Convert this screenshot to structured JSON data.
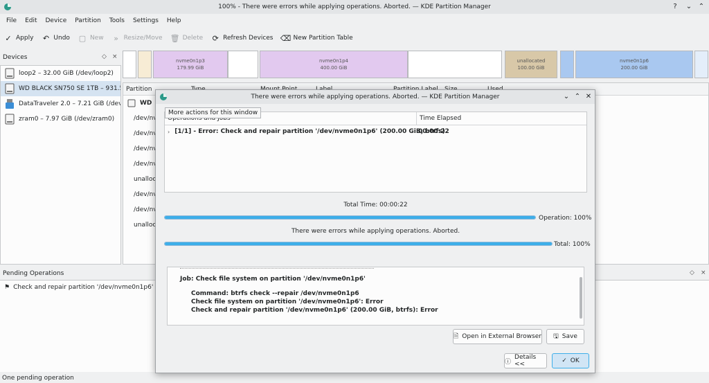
{
  "window": {
    "title": "100% - There were errors while applying operations. Aborted. — KDE Partition Manager"
  },
  "menu": [
    "File",
    "Edit",
    "Device",
    "Partition",
    "Tools",
    "Settings",
    "Help"
  ],
  "toolbar": {
    "apply": "Apply",
    "undo": "Undo",
    "new": "New",
    "resize_move": "Resize/Move",
    "delete": "Delete",
    "refresh": "Refresh Devices",
    "new_table": "New Partition Table"
  },
  "devices": {
    "header": "Devices",
    "items": [
      {
        "label": "loop2 – 32.00 GiB (/dev/loop2)",
        "icon": "drive-harddisk-icon"
      },
      {
        "label": "WD BLACK SN750 SE 1TB – 931.5...",
        "icon": "drive-harddisk-icon"
      },
      {
        "label": "DataTraveler 2.0 – 7.21 GiB (/dev...",
        "icon": "drive-removable-media-usb-icon"
      },
      {
        "label": "zram0 – 7.97 GiB (/dev/zram0)",
        "icon": "drive-harddisk-icon"
      }
    ]
  },
  "partition_map": {
    "segments": [
      {
        "name": "nvme0n1p3",
        "size": "179.99 GiB"
      },
      {
        "name": "nvme0n1p4",
        "size": "400.00 GiB"
      },
      {
        "name": "unallocated",
        "size": "100.00 GiB"
      },
      {
        "name": "nvme0n1p6",
        "size": "200.00 GiB"
      }
    ]
  },
  "partition_table": {
    "columns": [
      "Partition",
      "Type",
      "Mount Point",
      "Label",
      "Partition Label",
      "Size",
      "Used"
    ],
    "device_row": "WD",
    "rows": [
      "/dev/nv",
      "/dev/nv",
      "/dev/nv",
      "/dev/nv",
      "unalloca",
      "/dev/nv",
      "/dev/nv",
      "unalloca"
    ]
  },
  "pending": {
    "header": "Pending Operations",
    "items": [
      "Check and repair partition '/dev/nvme0n1p6' (200.00 GiB, btrfs)"
    ]
  },
  "status": "One pending operation",
  "dialog": {
    "title": "There were errors while applying operations. Aborted. — KDE Partition Manager",
    "tooltip": "More actions for this window",
    "columns": [
      "Operations and Jobs",
      "Time Elapsed"
    ],
    "job": {
      "label": "[1/1] - Error: Check and repair partition '/dev/nvme0n1p6' (200.00 GiB, btrfs)",
      "time": "00:00:22"
    },
    "total_time": "Total Time: 00:00:22",
    "operation_label": "Operation: 100%",
    "operation_progress": 1.0,
    "message": "There were errors while applying operations. Aborted.",
    "total_label": "Total: 100%",
    "total_progress": 1.0,
    "details": {
      "job": "Job: Check file system on partition '/dev/nvme0n1p6'",
      "lines": [
        "Command: btrfs check --repair /dev/nvme0n1p6",
        "Check file system on partition '/dev/nvme0n1p6': Error",
        "Check and repair partition '/dev/nvme0n1p6' (200.00 GiB, btrfs): Error"
      ]
    },
    "open_browser": "Open in External Browser",
    "save": "Save",
    "details_btn": "Details <<",
    "ok": "OK"
  },
  "colors": {
    "accent": "#3daee9",
    "selection": "#d5e3f1",
    "partition_btrfs": "#e2c9ef",
    "partition_unallocated": "#d8c8a8",
    "partition_ext": "#a9c8f0"
  }
}
